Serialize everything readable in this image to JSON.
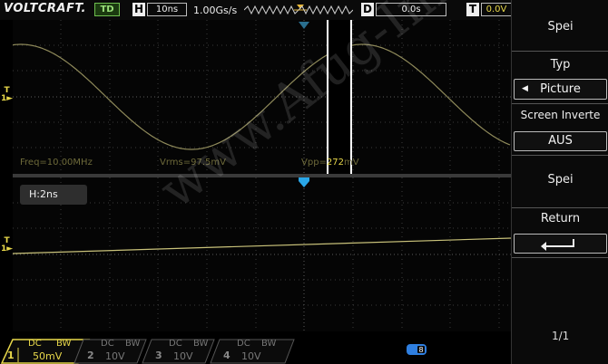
{
  "header": {
    "brand": "VOLTCRAFT.",
    "trigger_mode": "TD",
    "timebase_letter": "H",
    "timebase_value": "10ns",
    "sample_rate": "1.00Gs/s",
    "delay_letter": "D",
    "delay_value": "0.0s",
    "trigger_letter": "T",
    "trigger_value": "0.0V"
  },
  "measurements": {
    "freq": "Freq=10.00MHz",
    "vrms": "Vrms=97.5mV",
    "vpp_label": "Vpp=",
    "vpp_value": "272",
    "vpp_unit": "mV"
  },
  "zoom": {
    "label": "H:2ns"
  },
  "markers": {
    "ch1": "1"
  },
  "watermark": "www.Afug-Info.de",
  "menu": {
    "title": "Spei",
    "type_label": "Typ",
    "type_value": "Picture",
    "invert_label": "Screen Inverte",
    "invert_value": "AUS",
    "save_button": "Spei",
    "return_label": "Return",
    "page": "1/1"
  },
  "channels": [
    {
      "num": "1",
      "coupling": "DC",
      "bw": "BW",
      "scale": "50mV",
      "color": "#e8d84a"
    },
    {
      "num": "2",
      "coupling": "DC",
      "bw": "BW",
      "scale": "10V",
      "color": "#5a5a5a"
    },
    {
      "num": "3",
      "coupling": "DC",
      "bw": "BW",
      "scale": "10V",
      "color": "#5a5a5a"
    },
    {
      "num": "4",
      "coupling": "DC",
      "bw": "BW",
      "scale": "10V",
      "color": "#5a5a5a"
    }
  ],
  "colors": {
    "ch1_trace": "#c9c27a",
    "trigger_marker": "#2aa7e8",
    "background": "#000000"
  }
}
